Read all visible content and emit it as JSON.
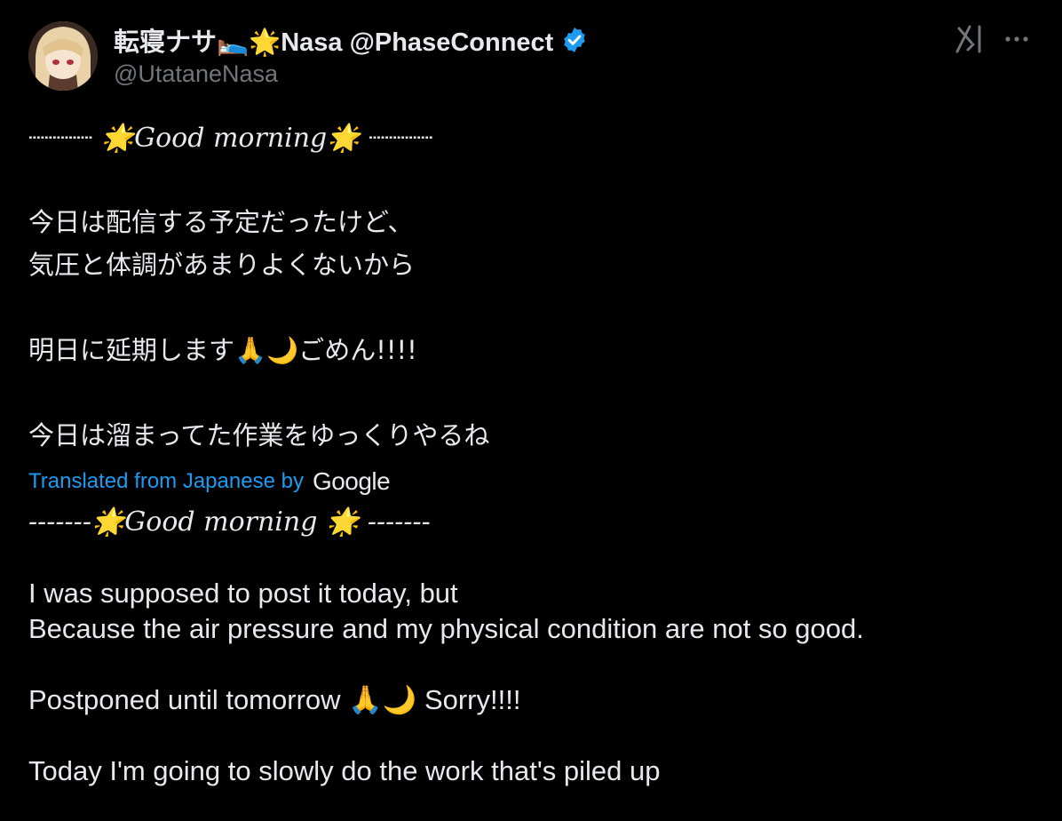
{
  "author": {
    "display_name": "転寝ナサ🛌🌟Nasa @PhaseConnect",
    "handle": "@UtataneNasa"
  },
  "original": {
    "line1": "┈┈┈┈ 🌟Good morning🌟 ┈┈┈┈",
    "line2": "今日は配信する予定だったけど、",
    "line3": "気圧と体調があまりよくないから",
    "line4": "明日に延期します🙏🌙ごめん!!!!",
    "line5": "今日は溜まってた作業をゆっくりやるね"
  },
  "translation": {
    "label": "Translated from Japanese by",
    "provider": "Google",
    "line1": "-------🌟Good morning  🌟 -------",
    "line2": "I was supposed to post it today, but",
    "line3": "Because the air pressure and my physical condition are not so good.",
    "line4": "Postponed until tomorrow 🙏🌙 Sorry!!!!",
    "line5": "Today I'm going to slowly do the work that's piled up"
  },
  "icons": {
    "verified": "verified-badge-icon",
    "grok": "grok-icon",
    "more": "more-options-icon"
  },
  "colors": {
    "background": "#000000",
    "text": "#e7e9ea",
    "secondary": "#71767b",
    "link": "#1d9bf0",
    "verified": "#1d9bf0"
  }
}
